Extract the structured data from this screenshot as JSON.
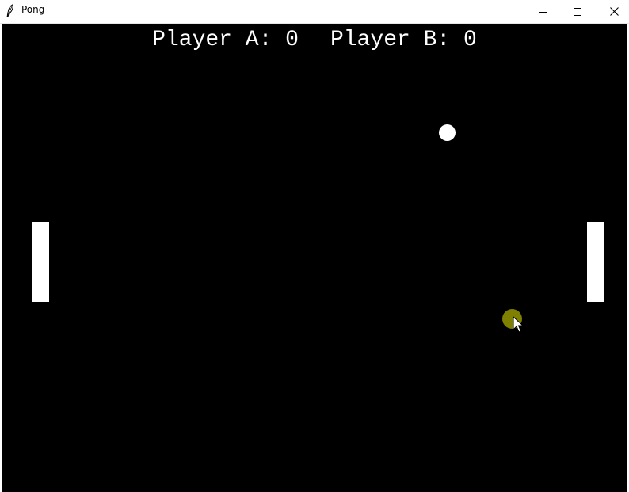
{
  "window": {
    "title": "Pong",
    "icon": "feather-icon",
    "controls": [
      "minimize-icon",
      "maximize-icon",
      "close-icon"
    ]
  },
  "game": {
    "background_color": "#000000",
    "foreground_color": "#ffffff",
    "score": {
      "player_a_label": "Player A: 0",
      "player_b_label": "Player B: 0",
      "player_a": 0,
      "player_b": 0
    }
  },
  "cursor": {
    "icon": "arrow-cursor-icon",
    "highlight_color": "#808000"
  }
}
